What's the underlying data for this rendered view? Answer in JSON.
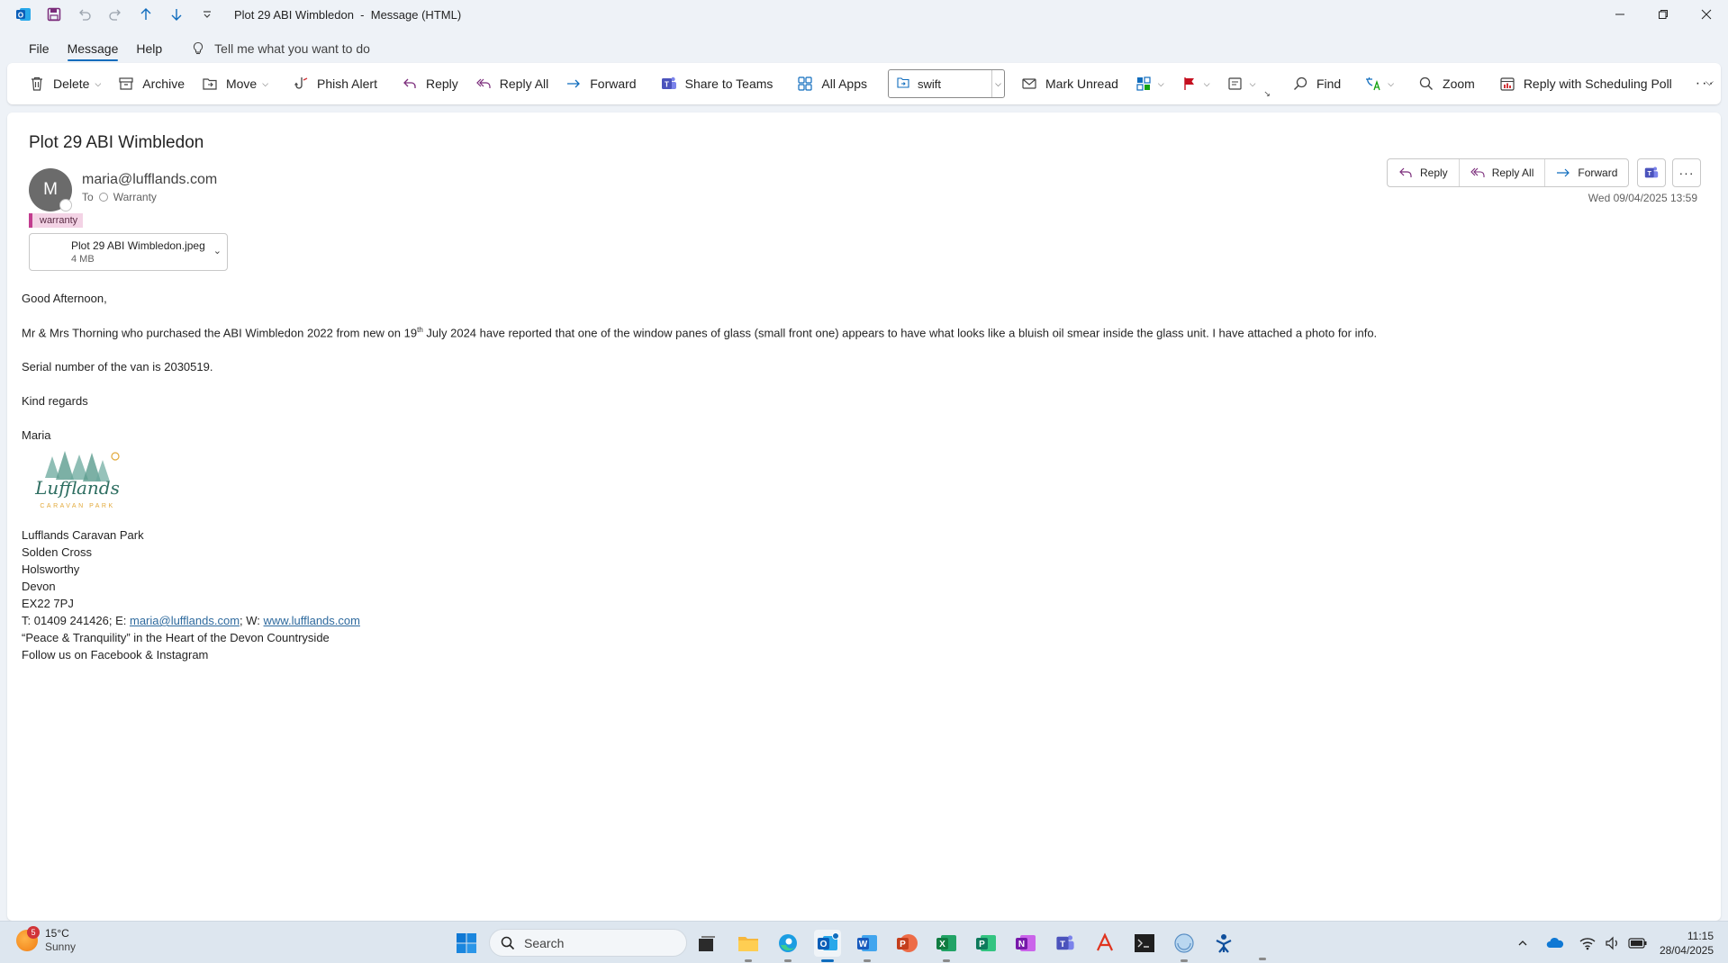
{
  "window": {
    "title": "Plot 29 ABI Wimbledon  -  Message (HTML)"
  },
  "menu": {
    "tabs": [
      "File",
      "Message",
      "Help"
    ],
    "active_tab": "Message",
    "tell_me": "Tell me what you want to do"
  },
  "ribbon": {
    "delete": "Delete",
    "archive": "Archive",
    "move": "Move",
    "phish_alert": "Phish Alert",
    "reply": "Reply",
    "reply_all": "Reply All",
    "forward": "Forward",
    "share_to_teams": "Share to Teams",
    "all_apps": "All Apps",
    "quick_step_value": "swift",
    "mark_unread": "Mark Unread",
    "find": "Find",
    "zoom": "Zoom",
    "reply_scheduling_poll": "Reply with Scheduling Poll"
  },
  "message": {
    "subject": "Plot 29 ABI Wimbledon",
    "avatar_initial": "M",
    "sender": "maria@lufflands.com",
    "to_label": "To",
    "to_recipient": "Warranty",
    "category": "warranty",
    "date": "Wed 09/04/2025 13:59",
    "attachment": {
      "name": "Plot 29 ABI Wimbledon.jpeg",
      "size": "4 MB"
    },
    "actions": {
      "reply": "Reply",
      "reply_all": "Reply All",
      "forward": "Forward"
    },
    "body": {
      "greeting": "Good Afternoon,",
      "p1_before": "Mr & Mrs Thorning who purchased the ABI Wimbledon 2022 from new on 19",
      "p1_sup": "th",
      "p1_after": " July 2024 have reported that one of the window panes of glass (small front one) appears to have what looks like a bluish oil smear inside the glass unit. I have attached a photo for info.",
      "p2": "Serial number of the van is 2030519.",
      "closing": "Kind regards",
      "name": "Maria"
    },
    "signature": {
      "logo_text": "Lufflands",
      "logo_sub": "CARAVAN PARK",
      "org": "Lufflands Caravan Park",
      "addr1": "Solden Cross",
      "addr2": "Holsworthy",
      "addr3": "Devon",
      "postcode": "EX22 7PJ",
      "phone_prefix": "T: 01409 241426; E: ",
      "email": "maria@lufflands.com",
      "web_prefix": "; W: ",
      "web": "www.lufflands.com",
      "tagline": "“Peace & Tranquility” in the Heart of the Devon Countryside",
      "social": "Follow us on Facebook & Instagram"
    }
  },
  "taskbar": {
    "weather_temp": "15°C",
    "weather_desc": "Sunny",
    "weather_badge": "5",
    "search_placeholder": "Search",
    "time": "11:15",
    "date": "28/04/2025"
  },
  "colors": {
    "accent": "#0f6cbd",
    "category_bar": "#c23c8f",
    "category_bg": "#f3d3e5",
    "link": "#2e6a9e"
  }
}
